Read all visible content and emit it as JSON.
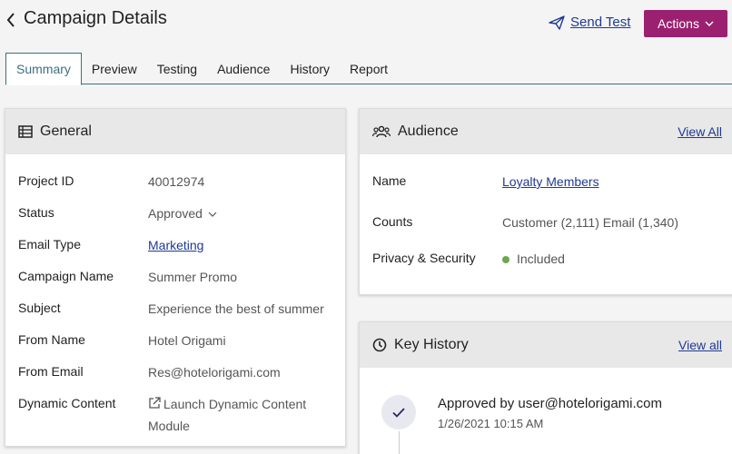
{
  "header": {
    "title": "Campaign Details",
    "send_test": "Send Test",
    "actions": "Actions"
  },
  "tabs": [
    {
      "label": "Summary",
      "active": true
    },
    {
      "label": "Preview"
    },
    {
      "label": "Testing"
    },
    {
      "label": "Audience"
    },
    {
      "label": "History"
    },
    {
      "label": "Report"
    }
  ],
  "general": {
    "title": "General",
    "rows": [
      {
        "label": "Project ID",
        "value": "40012974"
      },
      {
        "label": "Status",
        "value": "Approved"
      },
      {
        "label": "Email Type",
        "value": "Marketing"
      },
      {
        "label": "Campaign Name",
        "value": "Summer Promo"
      },
      {
        "label": "Subject",
        "value": "Experience the best of summer"
      },
      {
        "label": "From Name",
        "value": "Hotel Origami"
      },
      {
        "label": "From Email",
        "value": "Res@hotelorigami.com"
      },
      {
        "label": "Dynamic Content",
        "value": "Launch Dynamic Content Module"
      }
    ]
  },
  "audience": {
    "title": "Audience",
    "view_all": "View All",
    "rows": [
      {
        "label": "Name",
        "value": "Loyalty Members"
      },
      {
        "label": "Counts",
        "value": "Customer (2,111) Email (1,340)"
      },
      {
        "label": "Privacy & Security",
        "value": "Included"
      }
    ],
    "included_color": "#6aa84f"
  },
  "key_history": {
    "title": "Key History",
    "view_all": "View all",
    "items": [
      {
        "title": "Approved by user@hotelorigami.com",
        "time": "1/26/2021 10:15 AM"
      }
    ]
  },
  "colors": {
    "accent": "#9b2170",
    "link": "#1f3a93",
    "tab_active": "#3d6f7e"
  }
}
